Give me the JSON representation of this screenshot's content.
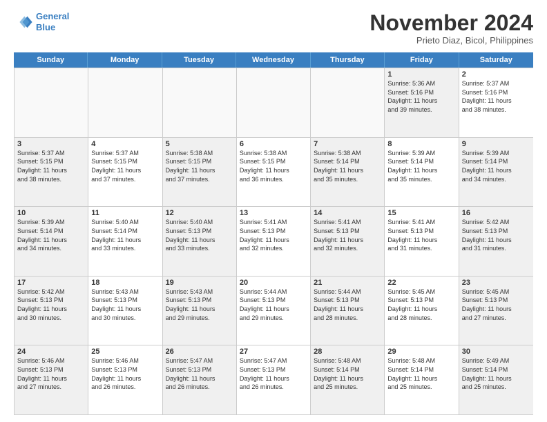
{
  "logo": {
    "line1": "General",
    "line2": "Blue"
  },
  "title": "November 2024",
  "location": "Prieto Diaz, Bicol, Philippines",
  "header_days": [
    "Sunday",
    "Monday",
    "Tuesday",
    "Wednesday",
    "Thursday",
    "Friday",
    "Saturday"
  ],
  "weeks": [
    [
      {
        "day": "",
        "info": "",
        "empty": true
      },
      {
        "day": "",
        "info": "",
        "empty": true
      },
      {
        "day": "",
        "info": "",
        "empty": true
      },
      {
        "day": "",
        "info": "",
        "empty": true
      },
      {
        "day": "",
        "info": "",
        "empty": true
      },
      {
        "day": "1",
        "info": "Sunrise: 5:36 AM\nSunset: 5:16 PM\nDaylight: 11 hours\nand 39 minutes.",
        "empty": false,
        "shaded": true
      },
      {
        "day": "2",
        "info": "Sunrise: 5:37 AM\nSunset: 5:16 PM\nDaylight: 11 hours\nand 38 minutes.",
        "empty": false,
        "shaded": false
      }
    ],
    [
      {
        "day": "3",
        "info": "Sunrise: 5:37 AM\nSunset: 5:15 PM\nDaylight: 11 hours\nand 38 minutes.",
        "empty": false,
        "shaded": true
      },
      {
        "day": "4",
        "info": "Sunrise: 5:37 AM\nSunset: 5:15 PM\nDaylight: 11 hours\nand 37 minutes.",
        "empty": false,
        "shaded": false
      },
      {
        "day": "5",
        "info": "Sunrise: 5:38 AM\nSunset: 5:15 PM\nDaylight: 11 hours\nand 37 minutes.",
        "empty": false,
        "shaded": true
      },
      {
        "day": "6",
        "info": "Sunrise: 5:38 AM\nSunset: 5:15 PM\nDaylight: 11 hours\nand 36 minutes.",
        "empty": false,
        "shaded": false
      },
      {
        "day": "7",
        "info": "Sunrise: 5:38 AM\nSunset: 5:14 PM\nDaylight: 11 hours\nand 35 minutes.",
        "empty": false,
        "shaded": true
      },
      {
        "day": "8",
        "info": "Sunrise: 5:39 AM\nSunset: 5:14 PM\nDaylight: 11 hours\nand 35 minutes.",
        "empty": false,
        "shaded": false
      },
      {
        "day": "9",
        "info": "Sunrise: 5:39 AM\nSunset: 5:14 PM\nDaylight: 11 hours\nand 34 minutes.",
        "empty": false,
        "shaded": true
      }
    ],
    [
      {
        "day": "10",
        "info": "Sunrise: 5:39 AM\nSunset: 5:14 PM\nDaylight: 11 hours\nand 34 minutes.",
        "empty": false,
        "shaded": true
      },
      {
        "day": "11",
        "info": "Sunrise: 5:40 AM\nSunset: 5:14 PM\nDaylight: 11 hours\nand 33 minutes.",
        "empty": false,
        "shaded": false
      },
      {
        "day": "12",
        "info": "Sunrise: 5:40 AM\nSunset: 5:13 PM\nDaylight: 11 hours\nand 33 minutes.",
        "empty": false,
        "shaded": true
      },
      {
        "day": "13",
        "info": "Sunrise: 5:41 AM\nSunset: 5:13 PM\nDaylight: 11 hours\nand 32 minutes.",
        "empty": false,
        "shaded": false
      },
      {
        "day": "14",
        "info": "Sunrise: 5:41 AM\nSunset: 5:13 PM\nDaylight: 11 hours\nand 32 minutes.",
        "empty": false,
        "shaded": true
      },
      {
        "day": "15",
        "info": "Sunrise: 5:41 AM\nSunset: 5:13 PM\nDaylight: 11 hours\nand 31 minutes.",
        "empty": false,
        "shaded": false
      },
      {
        "day": "16",
        "info": "Sunrise: 5:42 AM\nSunset: 5:13 PM\nDaylight: 11 hours\nand 31 minutes.",
        "empty": false,
        "shaded": true
      }
    ],
    [
      {
        "day": "17",
        "info": "Sunrise: 5:42 AM\nSunset: 5:13 PM\nDaylight: 11 hours\nand 30 minutes.",
        "empty": false,
        "shaded": true
      },
      {
        "day": "18",
        "info": "Sunrise: 5:43 AM\nSunset: 5:13 PM\nDaylight: 11 hours\nand 30 minutes.",
        "empty": false,
        "shaded": false
      },
      {
        "day": "19",
        "info": "Sunrise: 5:43 AM\nSunset: 5:13 PM\nDaylight: 11 hours\nand 29 minutes.",
        "empty": false,
        "shaded": true
      },
      {
        "day": "20",
        "info": "Sunrise: 5:44 AM\nSunset: 5:13 PM\nDaylight: 11 hours\nand 29 minutes.",
        "empty": false,
        "shaded": false
      },
      {
        "day": "21",
        "info": "Sunrise: 5:44 AM\nSunset: 5:13 PM\nDaylight: 11 hours\nand 28 minutes.",
        "empty": false,
        "shaded": true
      },
      {
        "day": "22",
        "info": "Sunrise: 5:45 AM\nSunset: 5:13 PM\nDaylight: 11 hours\nand 28 minutes.",
        "empty": false,
        "shaded": false
      },
      {
        "day": "23",
        "info": "Sunrise: 5:45 AM\nSunset: 5:13 PM\nDaylight: 11 hours\nand 27 minutes.",
        "empty": false,
        "shaded": true
      }
    ],
    [
      {
        "day": "24",
        "info": "Sunrise: 5:46 AM\nSunset: 5:13 PM\nDaylight: 11 hours\nand 27 minutes.",
        "empty": false,
        "shaded": true
      },
      {
        "day": "25",
        "info": "Sunrise: 5:46 AM\nSunset: 5:13 PM\nDaylight: 11 hours\nand 26 minutes.",
        "empty": false,
        "shaded": false
      },
      {
        "day": "26",
        "info": "Sunrise: 5:47 AM\nSunset: 5:13 PM\nDaylight: 11 hours\nand 26 minutes.",
        "empty": false,
        "shaded": true
      },
      {
        "day": "27",
        "info": "Sunrise: 5:47 AM\nSunset: 5:13 PM\nDaylight: 11 hours\nand 26 minutes.",
        "empty": false,
        "shaded": false
      },
      {
        "day": "28",
        "info": "Sunrise: 5:48 AM\nSunset: 5:14 PM\nDaylight: 11 hours\nand 25 minutes.",
        "empty": false,
        "shaded": true
      },
      {
        "day": "29",
        "info": "Sunrise: 5:48 AM\nSunset: 5:14 PM\nDaylight: 11 hours\nand 25 minutes.",
        "empty": false,
        "shaded": false
      },
      {
        "day": "30",
        "info": "Sunrise: 5:49 AM\nSunset: 5:14 PM\nDaylight: 11 hours\nand 25 minutes.",
        "empty": false,
        "shaded": true
      }
    ]
  ]
}
